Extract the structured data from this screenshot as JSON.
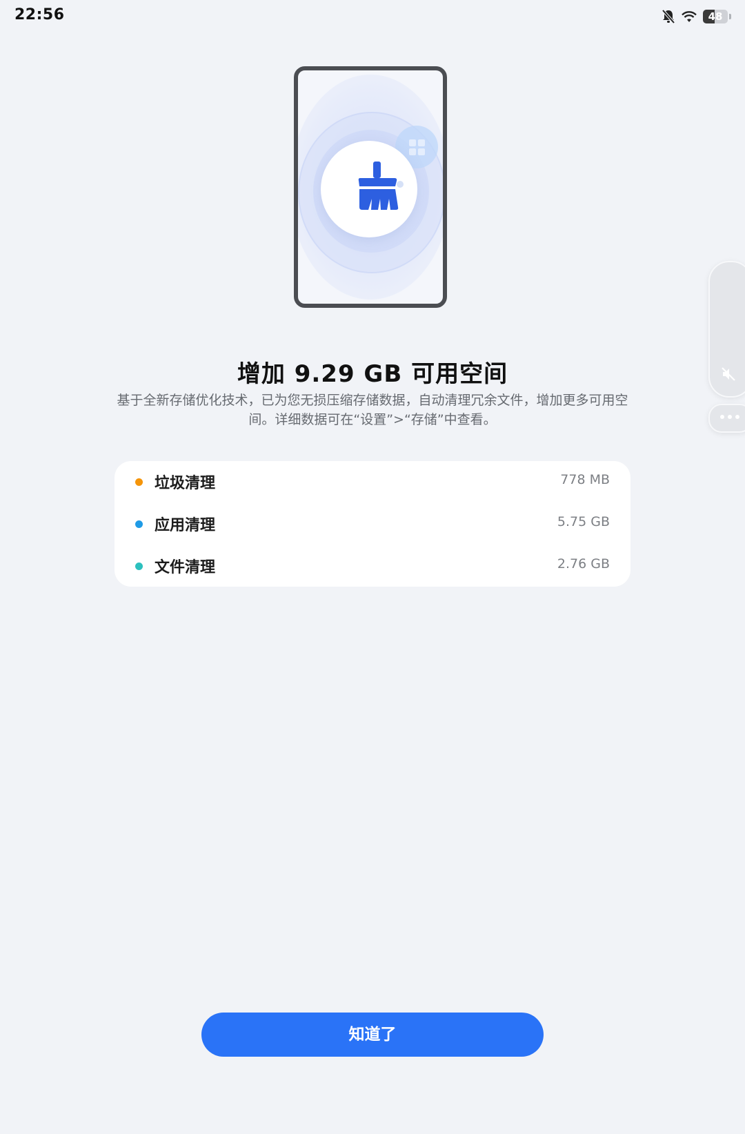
{
  "status_bar": {
    "time": "22:56",
    "battery_level": "48",
    "battery_fraction": 0.48,
    "icons": [
      "bell-muted-icon",
      "wifi-icon",
      "battery-icon"
    ]
  },
  "illustration": {
    "icons": [
      "broom-icon",
      "grid-bubble-icon"
    ]
  },
  "header": {
    "title": "增加 9.29 GB 可用空间",
    "description": "基于全新存储优化技术，已为您无损压缩存储数据，自动清理冗余文件，增加更多可用空间。详细数据可在“设置”>“存储”中查看。"
  },
  "cleanup_items": [
    {
      "label": "垃圾清理",
      "value": "778 MB",
      "color": "#f5950a"
    },
    {
      "label": "应用清理",
      "value": "5.75 GB",
      "color": "#1f9be6"
    },
    {
      "label": "文件清理",
      "value": "2.76 GB",
      "color": "#2cc0be"
    }
  ],
  "side_panel": {
    "icons": [
      "volume-mute-icon",
      "more-icon"
    ]
  },
  "actions": {
    "ok_label": "知道了"
  },
  "colors": {
    "background": "#f1f3f7",
    "accent": "#2a73f7",
    "card": "#ffffff"
  }
}
